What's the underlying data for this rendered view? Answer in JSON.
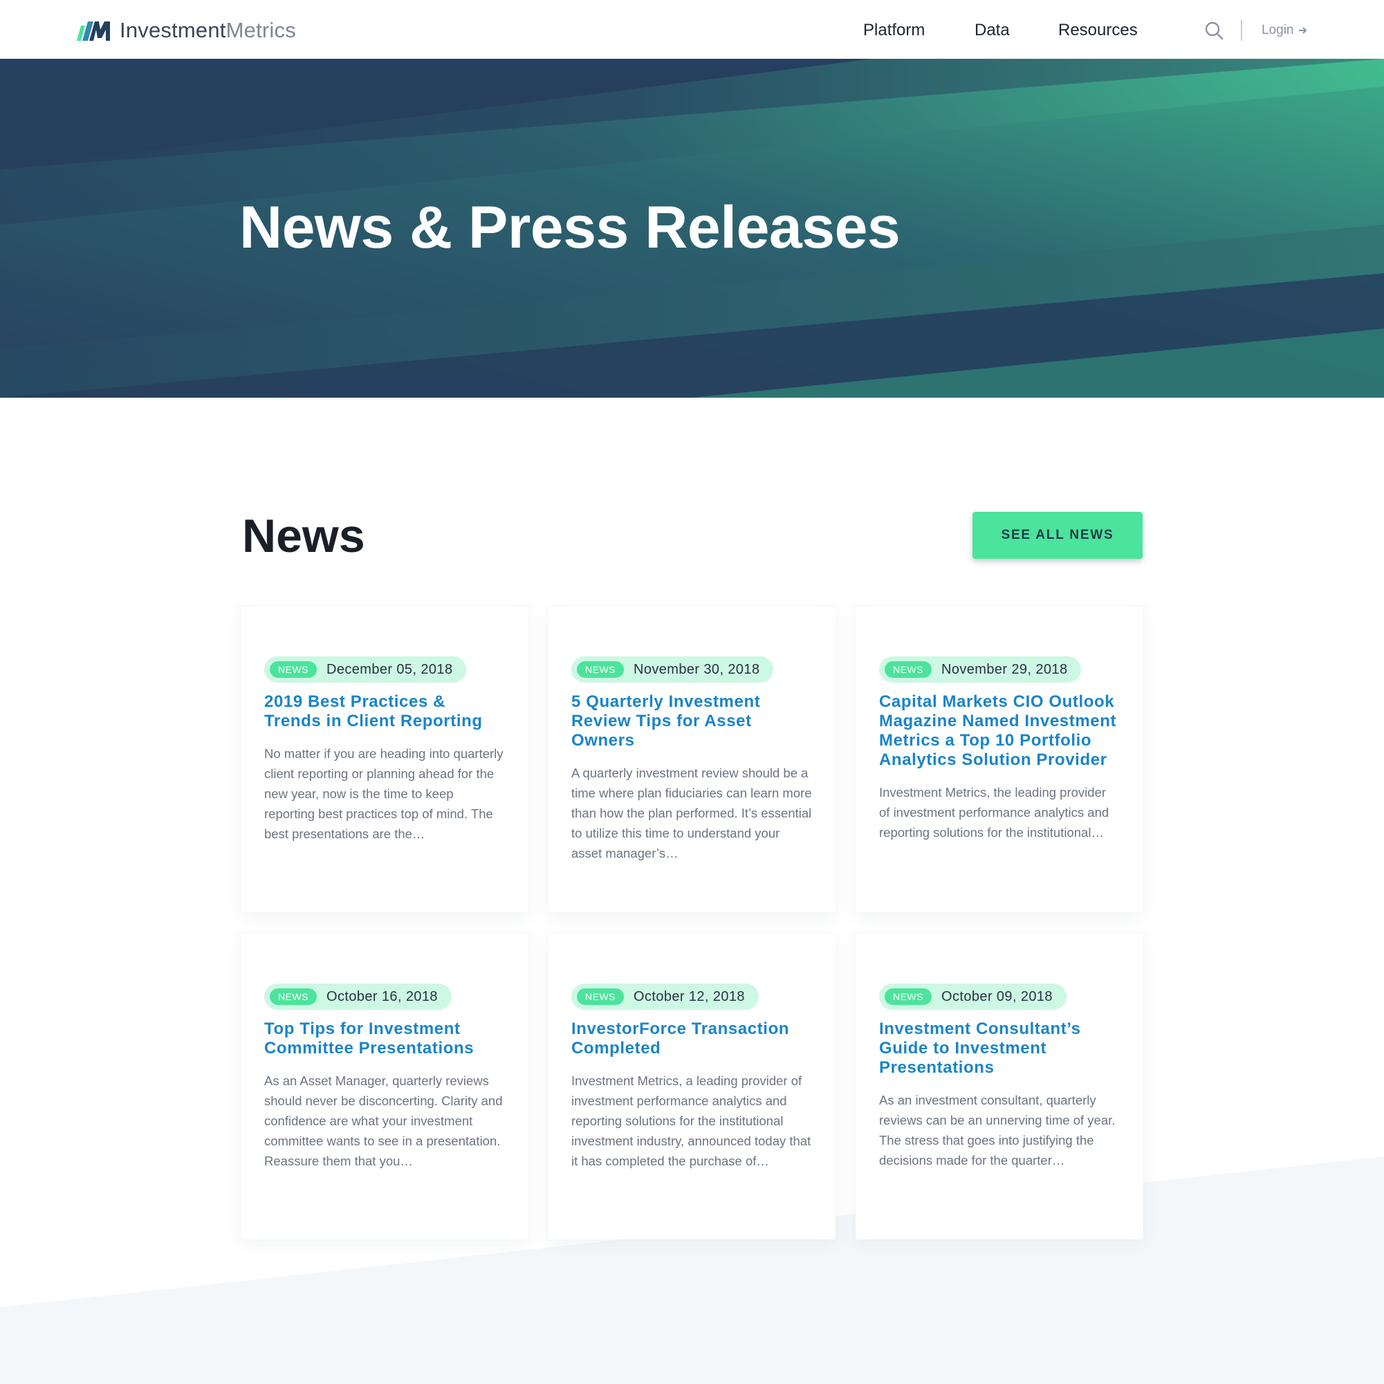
{
  "header": {
    "logo_text_primary": "Investment",
    "logo_text_secondary": "Metrics",
    "nav": [
      "Platform",
      "Data",
      "Resources"
    ],
    "login_label": "Login"
  },
  "hero": {
    "title": "News & Press Releases"
  },
  "news": {
    "section_title": "News",
    "see_all_label": "SEE ALL NEWS",
    "items": [
      {
        "badge": "NEWS",
        "date": "December 05, 2018",
        "title": "2019 Best Practices & Trends in Client Reporting",
        "excerpt": "No matter if you are heading into quarterly client reporting or planning ahead for the new year, now is the time to keep reporting best practices top of mind.  The best presentations are the…"
      },
      {
        "badge": "NEWS",
        "date": "November 30, 2018",
        "title": "5 Quarterly Investment Review Tips for Asset Owners",
        "excerpt": "A quarterly investment review should be a time where plan fiduciaries can learn more than how the plan performed. It’s essential to utilize this time to understand your asset manager’s…"
      },
      {
        "badge": "NEWS",
        "date": "November 29, 2018",
        "title": "Capital Markets CIO Outlook Magazine Named Investment Metrics a Top 10 Portfolio Analytics Solution Provider",
        "excerpt": "Investment Metrics, the leading provider of investment performance analytics and reporting solutions for the institutional…"
      },
      {
        "badge": "NEWS",
        "date": "October 16, 2018",
        "title": "Top Tips for Investment Committee Presentations",
        "excerpt": "As an Asset Manager, quarterly reviews should never be disconcerting. Clarity and confidence are what your investment committee wants to see in a presentation. Reassure them that you…"
      },
      {
        "badge": "NEWS",
        "date": "October 12, 2018",
        "title": "InvestorForce Transaction Completed",
        "excerpt": "Investment Metrics, a leading provider of investment performance analytics and reporting solutions for the institutional investment industry, announced today that it has completed the purchase of…"
      },
      {
        "badge": "NEWS",
        "date": "October 09, 2018",
        "title": "Investment Consultant’s Guide to Investment Presentations",
        "excerpt": "As an investment consultant, quarterly reviews can be an unnerving time of year. The stress that goes into justifying the decisions made for the quarter…"
      }
    ]
  },
  "colors": {
    "accent_green": "#4ce39c",
    "badge_bg": "#ccf8e4",
    "title_blue": "#1a84c8",
    "hero_navy": "#263f5e",
    "hero_teal": "#2f7a73"
  },
  "icons": [
    "logo-mark-icon",
    "search-icon",
    "arrow-right-icon"
  ]
}
